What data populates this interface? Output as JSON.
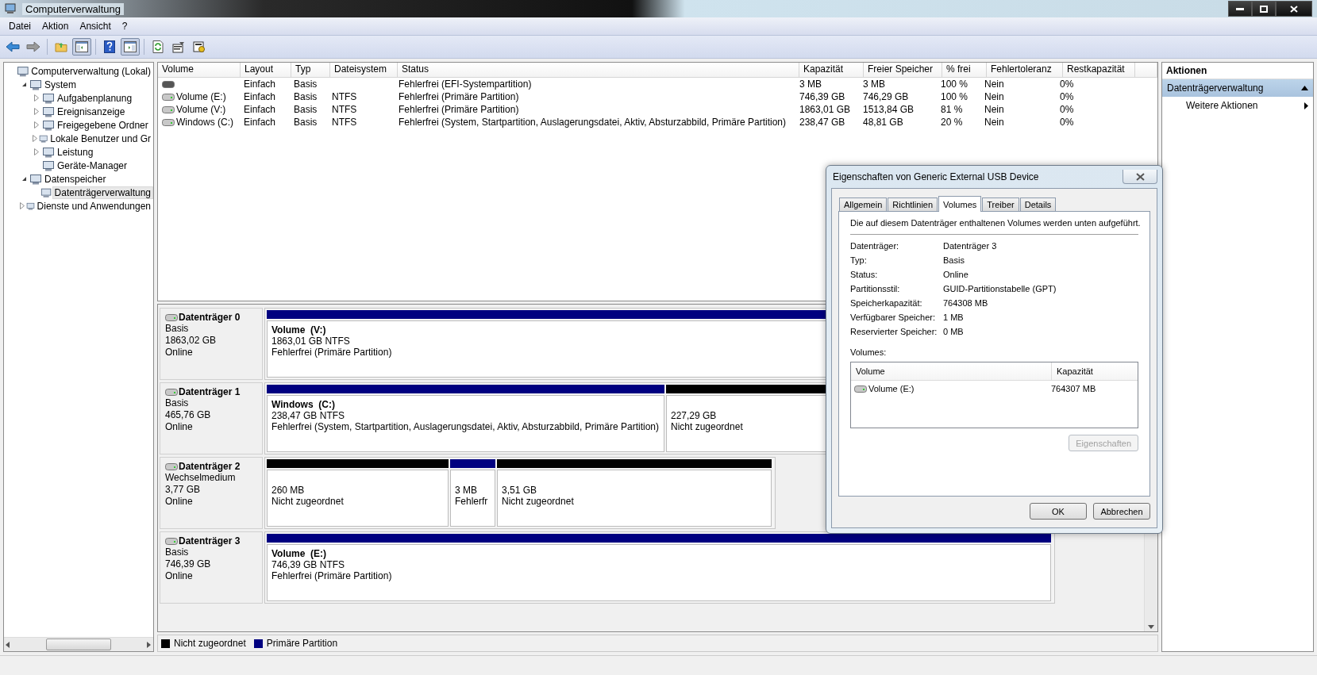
{
  "window": {
    "title": "Computerverwaltung"
  },
  "menu": [
    "Datei",
    "Aktion",
    "Ansicht",
    "?"
  ],
  "toolbar": [
    {
      "kind": "back",
      "pressed": false
    },
    {
      "kind": "forward",
      "pressed": false
    },
    {
      "kind": "up",
      "pressed": false
    },
    {
      "kind": "tree",
      "pressed": true
    },
    {
      "kind": "help",
      "pressed": false
    },
    {
      "kind": "pane",
      "pressed": true
    },
    {
      "kind": "refresh",
      "pressed": false
    },
    {
      "kind": "properties",
      "pressed": false
    },
    {
      "kind": "settings",
      "pressed": false
    }
  ],
  "tree": [
    {
      "label": "Computerverwaltung (Lokal)",
      "selected": false,
      "children": [
        {
          "label": "System",
          "expanded": true,
          "selected": false,
          "children": [
            {
              "label": "Aufgabenplanung",
              "expanded": false,
              "selected": false
            },
            {
              "label": "Ereignisanzeige",
              "expanded": false,
              "selected": false
            },
            {
              "label": "Freigegebene Ordner",
              "expanded": false,
              "selected": false
            },
            {
              "label": "Lokale Benutzer und Gr",
              "expanded": false,
              "selected": false
            },
            {
              "label": "Leistung",
              "expanded": false,
              "selected": false
            },
            {
              "label": "Geräte-Manager",
              "selected": false
            }
          ]
        },
        {
          "label": "Datenspeicher",
          "expanded": true,
          "selected": false,
          "children": [
            {
              "label": "Datenträgerverwaltung",
              "selected": true
            }
          ]
        },
        {
          "label": "Dienste und Anwendungen",
          "expanded": false,
          "selected": false
        }
      ]
    }
  ],
  "table": {
    "columns": [
      "Volume",
      "Layout",
      "Typ",
      "Dateisystem",
      "Status",
      "Kapazität",
      "Freier Speicher",
      "% frei",
      "Fehlertoleranz",
      "Restkapazität"
    ],
    "rows": [
      [
        "",
        "Einfach",
        "Basis",
        "",
        "Fehlerfrei (EFI-Systempartition)",
        "3 MB",
        "3 MB",
        "100 %",
        "Nein",
        "0%"
      ],
      [
        "Volume (E:)",
        "Einfach",
        "Basis",
        "NTFS",
        "Fehlerfrei (Primäre Partition)",
        "746,39 GB",
        "746,29 GB",
        "100 %",
        "Nein",
        "0%"
      ],
      [
        "Volume (V:)",
        "Einfach",
        "Basis",
        "NTFS",
        "Fehlerfrei (Primäre Partition)",
        "1863,01 GB",
        "1513,84 GB",
        "81 %",
        "Nein",
        "0%"
      ],
      [
        "Windows (C:)",
        "Einfach",
        "Basis",
        "NTFS",
        "Fehlerfrei (System, Startpartition, Auslagerungsdatei, Aktiv, Absturzabbild, Primäre Partition)",
        "238,47 GB",
        "48,81 GB",
        "20 %",
        "Nein",
        "0%"
      ]
    ]
  },
  "disks": [
    {
      "name": "Datenträger 0",
      "type": "Basis",
      "size": "1863,02 GB",
      "status": "Online",
      "partitions": [
        {
          "kind": "primary",
          "label": "Volume  (V:)",
          "size": "1863,01 GB NTFS",
          "status": "Fehlerfrei (Primäre Partition)"
        }
      ]
    },
    {
      "name": "Datenträger 1",
      "type": "Basis",
      "size": "465,76 GB",
      "status": "Online",
      "partitions": [
        {
          "kind": "primary",
          "label": "Windows  (C:)",
          "size": "238,47 GB NTFS",
          "status": "Fehlerfrei (System, Startpartition, Auslagerungsdatei, Aktiv, Absturzabbild, Primäre Partition)"
        },
        {
          "kind": "unallocated",
          "size": "227,29 GB",
          "status": "Nicht zugeordnet"
        }
      ]
    },
    {
      "name": "Datenträger 2",
      "type": "Wechselmedium",
      "size": "3,77 GB",
      "status": "Online",
      "partitions": [
        {
          "kind": "unallocated",
          "size": "260 MB",
          "status": "Nicht zugeordnet"
        },
        {
          "kind": "primary",
          "size": "3 MB",
          "status": "Fehlerfr"
        },
        {
          "kind": "unallocated",
          "size": "3,51 GB",
          "status": "Nicht zugeordnet"
        }
      ]
    },
    {
      "name": "Datenträger 3",
      "type": "Basis",
      "size": "746,39 GB",
      "status": "Online",
      "partitions": [
        {
          "kind": "primary",
          "label": "Volume  (E:)",
          "size": "746,39 GB NTFS",
          "status": "Fehlerfrei (Primäre Partition)"
        }
      ]
    }
  ],
  "legend": [
    {
      "label": "Nicht zugeordnet",
      "color": "#000000"
    },
    {
      "label": "Primäre Partition",
      "color": "#000080"
    }
  ],
  "actions": {
    "title": "Aktionen",
    "section": {
      "label": "Datenträgerverwaltung",
      "expanded": true
    },
    "items": [
      "Weitere Aktionen"
    ]
  },
  "dialog": {
    "title": "Eigenschaften von Generic External USB Device",
    "tabs": [
      {
        "label": "Allgemein",
        "selected": false
      },
      {
        "label": "Richtlinien",
        "selected": false
      },
      {
        "label": "Volumes",
        "selected": true
      },
      {
        "label": "Treiber",
        "selected": false
      },
      {
        "label": "Details",
        "selected": false
      }
    ],
    "intro": "Die auf diesem Datenträger enthaltenen Volumes werden unten aufgeführt.",
    "properties": [
      {
        "label": "Datenträger:",
        "value": "Datenträger 3"
      },
      {
        "label": "Typ:",
        "value": "Basis"
      },
      {
        "label": "Status:",
        "value": "Online"
      },
      {
        "label": "Partitionsstil:",
        "value": "GUID-Partitionstabelle (GPT)"
      },
      {
        "label": "Speicherkapazität:",
        "value": "764308 MB"
      },
      {
        "label": "Verfügbarer Speicher:",
        "value": "1 MB"
      },
      {
        "label": "Reservierter Speicher:",
        "value": "0 MB"
      }
    ],
    "volumes_label": "Volumes:",
    "volumes": {
      "columns": [
        "Volume",
        "Kapazität"
      ],
      "rows": [
        [
          "Volume (E:)",
          "764307 MB"
        ]
      ]
    },
    "buttons": [
      {
        "label": "Eigenschaften",
        "disabled": true
      },
      {
        "label": "OK",
        "disabled": false
      },
      {
        "label": "Abbrechen",
        "disabled": false
      }
    ]
  }
}
